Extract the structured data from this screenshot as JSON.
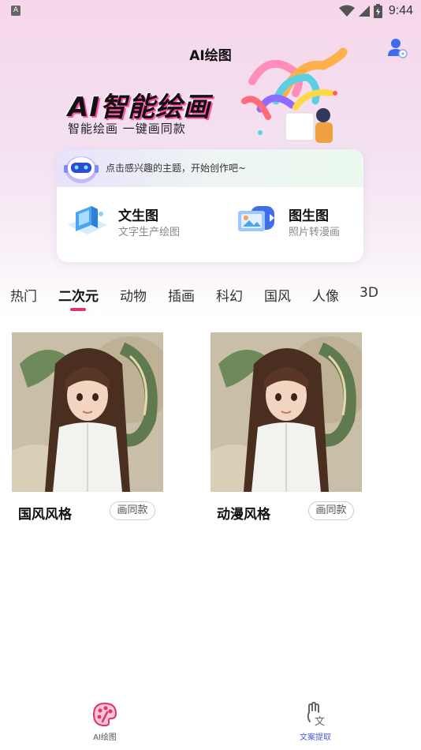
{
  "status": {
    "indicator": "A",
    "time": "9:44",
    "icons": [
      "wifi-icon",
      "signal-icon",
      "battery-icon"
    ]
  },
  "header": {
    "title": "AI绘图",
    "profile_icon": "user-profile-icon"
  },
  "banner": {
    "title": "AI智能绘画",
    "subtitle": "智能绘画 一键画同款"
  },
  "card": {
    "tip": "点击感兴趣的主题，开始创作吧~",
    "tools": [
      {
        "title": "文生图",
        "desc": "文字生产绘图",
        "icon": "text-to-image-icon"
      },
      {
        "title": "图生图",
        "desc": "照片转漫画",
        "icon": "image-to-image-icon"
      }
    ]
  },
  "tabs": {
    "items": [
      "热门",
      "二次元",
      "动物",
      "插画",
      "科幻",
      "国风",
      "人像",
      "3D"
    ],
    "active": "二次元"
  },
  "gallery": {
    "items": [
      {
        "title": "国风风格",
        "button": "画同款"
      },
      {
        "title": "动漫风格",
        "button": "画同款"
      }
    ]
  },
  "bottom_nav": {
    "items": [
      {
        "label": "AI绘图",
        "icon": "palette-icon",
        "active": true
      },
      {
        "label": "文案提取",
        "icon": "text-extract-icon",
        "active": false
      }
    ]
  },
  "colors": {
    "accent": "#e0336f",
    "nav_active": "#e0336f",
    "nav_inactive": "#4a5bd8"
  }
}
